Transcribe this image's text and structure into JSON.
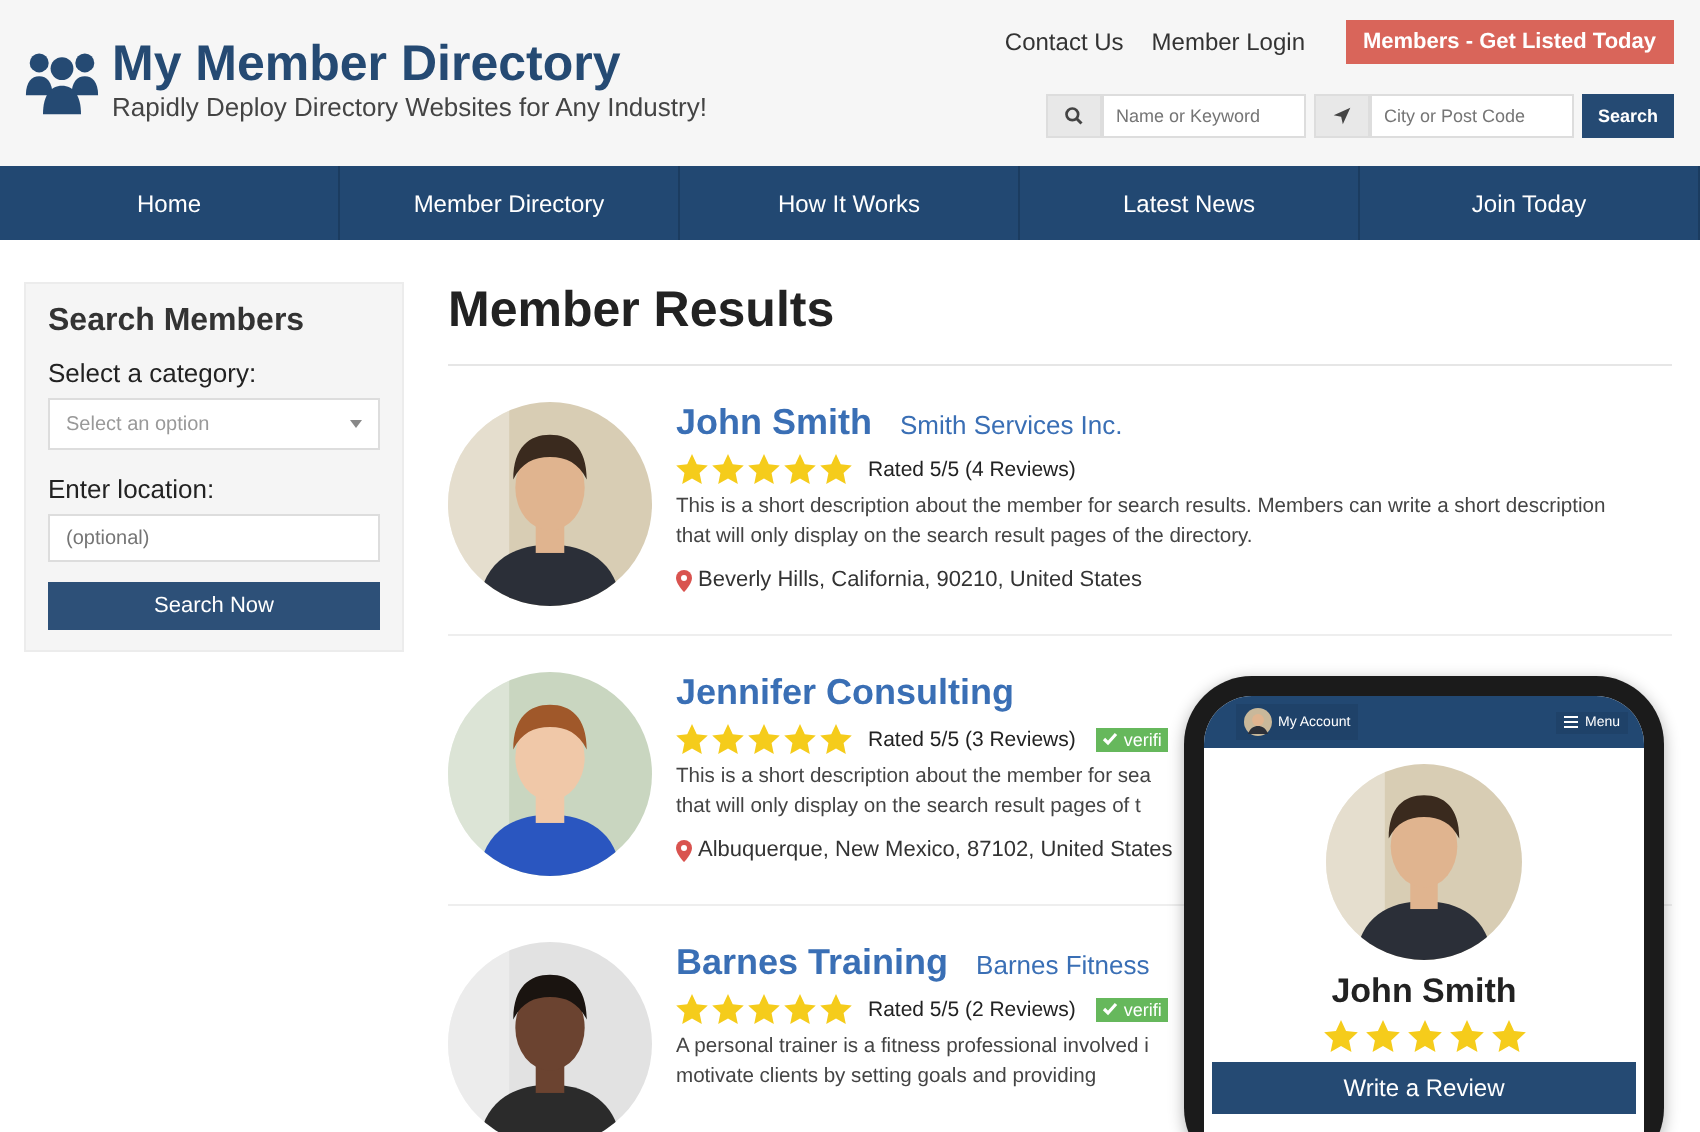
{
  "header": {
    "title": "My Member Directory",
    "tagline": "Rapidly Deploy Directory Websites for Any Industry!",
    "links": [
      "Contact Us",
      "Member Login"
    ],
    "cta": "Members - Get Listed Today",
    "keyword": {
      "placeholder": "Name or Keyword"
    },
    "location": {
      "placeholder": "City or Post Code"
    },
    "search_button": "Search"
  },
  "nav": [
    {
      "label": "Home",
      "selected": false
    },
    {
      "label": "Member Directory",
      "selected": false
    },
    {
      "label": "How It Works",
      "selected": false
    },
    {
      "label": "Latest News",
      "selected": false
    },
    {
      "label": "Join Today",
      "selected": false
    }
  ],
  "sidebar": {
    "title": "Search Members",
    "category_label": "Select a category:",
    "category": {
      "placeholder": "Select an option"
    },
    "location_label": "Enter location:",
    "location": {
      "placeholder": "(optional)"
    },
    "button": "Search Now"
  },
  "results": {
    "title": "Member Results",
    "items": [
      {
        "name": "John Smith",
        "company": "Smith Services Inc.",
        "stars": 5,
        "rating": "Rated 5/5 (4 Reviews)",
        "lines": [
          "This is a short description about the member for search results. Members can write a short description",
          "that will only display on the search result pages of the directory."
        ],
        "address": "Beverly Hills, California, 90210, United States"
      },
      {
        "name": "Jennifer Consulting",
        "stars": 5,
        "rating": "Rated 5/5 (3 Reviews)",
        "badge": "verifi",
        "lines": [
          "This is a short description about the member for sea",
          "that will only display on the search result pages of t"
        ],
        "address": "Albuquerque, New Mexico, 87102, United States"
      },
      {
        "name": "Barnes Training",
        "company": "Barnes Fitness",
        "stars": 5,
        "rating": "Rated 5/5 (2 Reviews)",
        "badge": "verifi",
        "lines": [
          "A personal trainer is a fitness professional involved i",
          "motivate clients by setting goals and providing"
        ]
      }
    ]
  },
  "phone": {
    "account": "My Account",
    "menu": "Menu",
    "name": "John Smith",
    "stars": 5,
    "button": "Write a Review"
  }
}
